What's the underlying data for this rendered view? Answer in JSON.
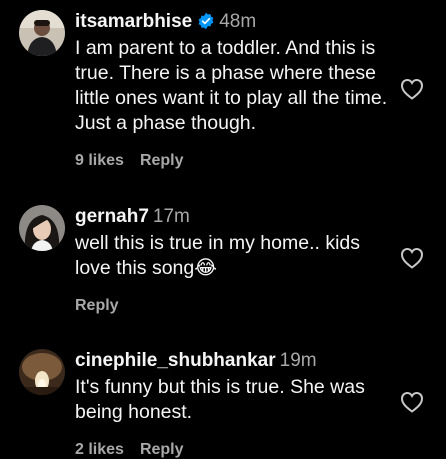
{
  "comments": [
    {
      "username": "itsamarbhise",
      "verified": true,
      "time": "48m",
      "text": "I am parent to a toddler. And this is true. There is a phase where these little ones want it to play all the time. Just a phase though.",
      "likes": "9 likes",
      "reply": "Reply",
      "icons": {
        "verified": "verified-badge-icon",
        "like": "heart-outline-icon"
      }
    },
    {
      "username": "gernah7",
      "verified": false,
      "time": "17m",
      "text": "well this is true in my home.. kids love this song😂",
      "likes": "",
      "reply": "Reply",
      "icons": {
        "like": "heart-outline-icon"
      }
    },
    {
      "username": "cinephile_shubhankar",
      "verified": false,
      "time": "19m",
      "text": "It's funny but this is true. She was being honest.",
      "likes": "2 likes",
      "reply": "Reply",
      "icons": {
        "like": "heart-outline-icon"
      }
    }
  ],
  "colors": {
    "background": "#000000",
    "primary_text": "#f5f5f5",
    "secondary_text": "#a8a8a8",
    "verified_blue": "#0095f6"
  }
}
